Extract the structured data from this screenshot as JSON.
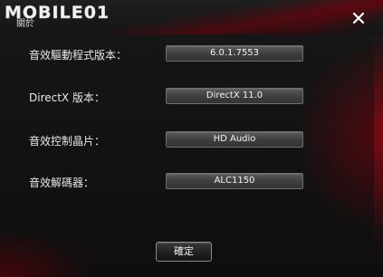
{
  "app": {
    "logo_text": "MOBILE01",
    "logo_subtext": "關於"
  },
  "titlebar": {
    "close_icon": "close-icon"
  },
  "info_rows": [
    {
      "label": "音效驅動程式版本：",
      "value": "6.0.1.7553"
    },
    {
      "label": "DirectX 版本：",
      "value": "DirectX 11.0"
    },
    {
      "label": "音效控制晶片：",
      "value": "HD Audio"
    },
    {
      "label": "音效解碼器：",
      "value": "ALC1150"
    }
  ],
  "footer": {
    "ok_label": "確定"
  },
  "colors": {
    "background": "#121213",
    "accent_red": "#8a000a",
    "text": "#e8e8e8",
    "value_field": "#3f3f3f"
  }
}
